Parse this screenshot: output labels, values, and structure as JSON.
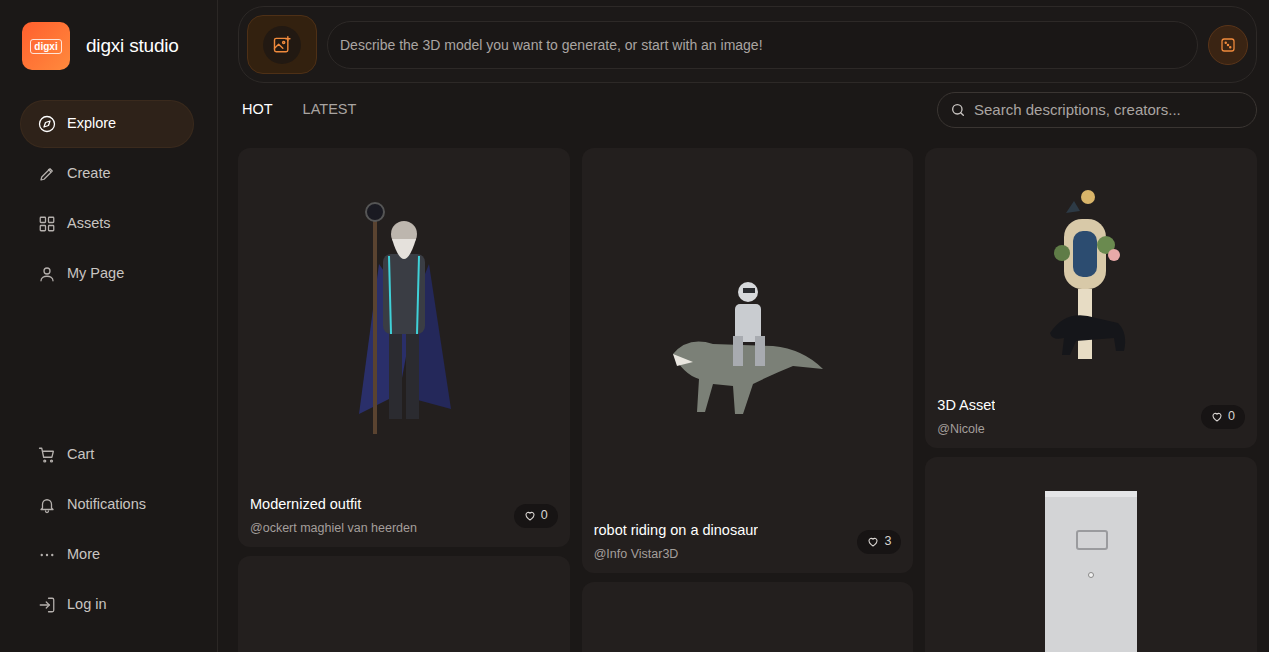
{
  "logo": {
    "badge": "digxi",
    "name": "digxi studio"
  },
  "nav": [
    {
      "label": "Explore",
      "selected": true
    },
    {
      "label": "Create",
      "selected": false
    },
    {
      "label": "Assets",
      "selected": false
    },
    {
      "label": "My Page",
      "selected": false
    }
  ],
  "bottom_nav": [
    "Cart",
    "Notifications",
    "More",
    "Log in"
  ],
  "prompt": {
    "placeholder": "Describe the 3D model you want to generate, or start with an image!"
  },
  "tabs": [
    {
      "label": "HOT",
      "selected": true
    },
    {
      "label": "LATEST",
      "selected": false
    }
  ],
  "search": {
    "placeholder": "Search descriptions, creators..."
  },
  "columns": [
    [
      {
        "kind": "wizard",
        "title": "Modernized outfit",
        "author": "@ockert maghiel van heerden",
        "likes": "0"
      },
      {
        "kind": "loading"
      }
    ],
    [
      {
        "kind": "robot",
        "title": "robot riding on a dinosaur",
        "author": "@Info Vistar3D",
        "likes": "3"
      },
      {
        "kind": "loading"
      }
    ],
    [
      {
        "kind": "asset",
        "title": "3D Asset",
        "author": "@Nicole",
        "likes": "0"
      },
      {
        "kind": "fridge"
      }
    ]
  ]
}
